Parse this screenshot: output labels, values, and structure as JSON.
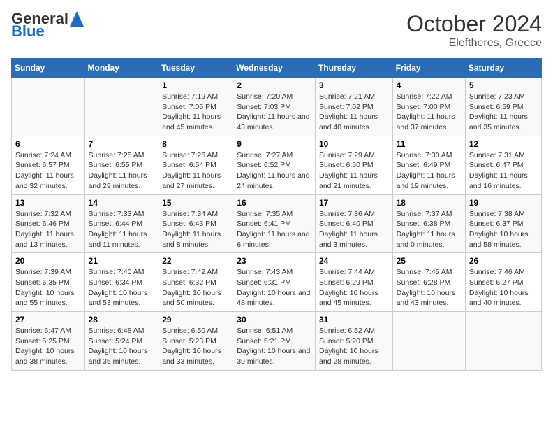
{
  "header": {
    "logo_general": "General",
    "logo_blue": "Blue",
    "title": "October 2024",
    "subtitle": "Eleftheres, Greece"
  },
  "columns": [
    "Sunday",
    "Monday",
    "Tuesday",
    "Wednesday",
    "Thursday",
    "Friday",
    "Saturday"
  ],
  "weeks": [
    [
      {
        "day": "",
        "text": ""
      },
      {
        "day": "",
        "text": ""
      },
      {
        "day": "1",
        "text": "Sunrise: 7:19 AM\nSunset: 7:05 PM\nDaylight: 11 hours and 45 minutes."
      },
      {
        "day": "2",
        "text": "Sunrise: 7:20 AM\nSunset: 7:03 PM\nDaylight: 11 hours and 43 minutes."
      },
      {
        "day": "3",
        "text": "Sunrise: 7:21 AM\nSunset: 7:02 PM\nDaylight: 11 hours and 40 minutes."
      },
      {
        "day": "4",
        "text": "Sunrise: 7:22 AM\nSunset: 7:00 PM\nDaylight: 11 hours and 37 minutes."
      },
      {
        "day": "5",
        "text": "Sunrise: 7:23 AM\nSunset: 6:59 PM\nDaylight: 11 hours and 35 minutes."
      }
    ],
    [
      {
        "day": "6",
        "text": "Sunrise: 7:24 AM\nSunset: 6:57 PM\nDaylight: 11 hours and 32 minutes."
      },
      {
        "day": "7",
        "text": "Sunrise: 7:25 AM\nSunset: 6:55 PM\nDaylight: 11 hours and 29 minutes."
      },
      {
        "day": "8",
        "text": "Sunrise: 7:26 AM\nSunset: 6:54 PM\nDaylight: 11 hours and 27 minutes."
      },
      {
        "day": "9",
        "text": "Sunrise: 7:27 AM\nSunset: 6:52 PM\nDaylight: 11 hours and 24 minutes."
      },
      {
        "day": "10",
        "text": "Sunrise: 7:29 AM\nSunset: 6:50 PM\nDaylight: 11 hours and 21 minutes."
      },
      {
        "day": "11",
        "text": "Sunrise: 7:30 AM\nSunset: 6:49 PM\nDaylight: 11 hours and 19 minutes."
      },
      {
        "day": "12",
        "text": "Sunrise: 7:31 AM\nSunset: 6:47 PM\nDaylight: 11 hours and 16 minutes."
      }
    ],
    [
      {
        "day": "13",
        "text": "Sunrise: 7:32 AM\nSunset: 6:46 PM\nDaylight: 11 hours and 13 minutes."
      },
      {
        "day": "14",
        "text": "Sunrise: 7:33 AM\nSunset: 6:44 PM\nDaylight: 11 hours and 11 minutes."
      },
      {
        "day": "15",
        "text": "Sunrise: 7:34 AM\nSunset: 6:43 PM\nDaylight: 11 hours and 8 minutes."
      },
      {
        "day": "16",
        "text": "Sunrise: 7:35 AM\nSunset: 6:41 PM\nDaylight: 11 hours and 6 minutes."
      },
      {
        "day": "17",
        "text": "Sunrise: 7:36 AM\nSunset: 6:40 PM\nDaylight: 11 hours and 3 minutes."
      },
      {
        "day": "18",
        "text": "Sunrise: 7:37 AM\nSunset: 6:38 PM\nDaylight: 11 hours and 0 minutes."
      },
      {
        "day": "19",
        "text": "Sunrise: 7:38 AM\nSunset: 6:37 PM\nDaylight: 10 hours and 58 minutes."
      }
    ],
    [
      {
        "day": "20",
        "text": "Sunrise: 7:39 AM\nSunset: 6:35 PM\nDaylight: 10 hours and 55 minutes."
      },
      {
        "day": "21",
        "text": "Sunrise: 7:40 AM\nSunset: 6:34 PM\nDaylight: 10 hours and 53 minutes."
      },
      {
        "day": "22",
        "text": "Sunrise: 7:42 AM\nSunset: 6:32 PM\nDaylight: 10 hours and 50 minutes."
      },
      {
        "day": "23",
        "text": "Sunrise: 7:43 AM\nSunset: 6:31 PM\nDaylight: 10 hours and 48 minutes."
      },
      {
        "day": "24",
        "text": "Sunrise: 7:44 AM\nSunset: 6:29 PM\nDaylight: 10 hours and 45 minutes."
      },
      {
        "day": "25",
        "text": "Sunrise: 7:45 AM\nSunset: 6:28 PM\nDaylight: 10 hours and 43 minutes."
      },
      {
        "day": "26",
        "text": "Sunrise: 7:46 AM\nSunset: 6:27 PM\nDaylight: 10 hours and 40 minutes."
      }
    ],
    [
      {
        "day": "27",
        "text": "Sunrise: 6:47 AM\nSunset: 5:25 PM\nDaylight: 10 hours and 38 minutes."
      },
      {
        "day": "28",
        "text": "Sunrise: 6:48 AM\nSunset: 5:24 PM\nDaylight: 10 hours and 35 minutes."
      },
      {
        "day": "29",
        "text": "Sunrise: 6:50 AM\nSunset: 5:23 PM\nDaylight: 10 hours and 33 minutes."
      },
      {
        "day": "30",
        "text": "Sunrise: 6:51 AM\nSunset: 5:21 PM\nDaylight: 10 hours and 30 minutes."
      },
      {
        "day": "31",
        "text": "Sunrise: 6:52 AM\nSunset: 5:20 PM\nDaylight: 10 hours and 28 minutes."
      },
      {
        "day": "",
        "text": ""
      },
      {
        "day": "",
        "text": ""
      }
    ]
  ]
}
